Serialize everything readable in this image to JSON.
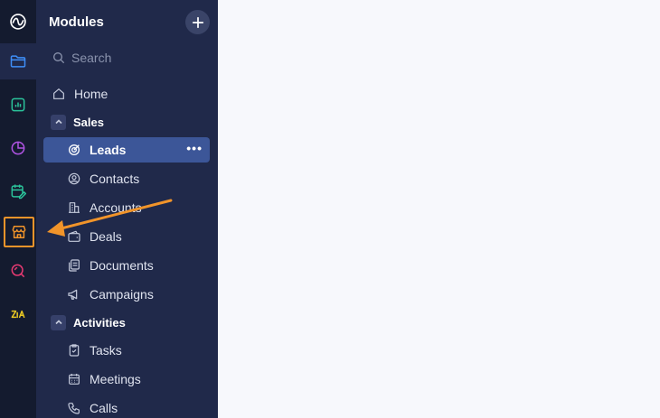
{
  "panel": {
    "title": "Modules",
    "search_placeholder": "Search"
  },
  "rail": {
    "items": [
      {
        "icon": "crm-logo-icon"
      },
      {
        "icon": "folder-icon",
        "active": true
      },
      {
        "icon": "analytics-icon"
      },
      {
        "icon": "pie-chart-icon"
      },
      {
        "icon": "calendar-edit-icon"
      },
      {
        "icon": "storefront-icon",
        "highlighted": true
      },
      {
        "icon": "search-zoom-icon"
      },
      {
        "icon": "zia-icon",
        "label": "Zia"
      }
    ]
  },
  "nav": {
    "home": "Home",
    "sales": {
      "label": "Sales",
      "items": [
        "Leads",
        "Contacts",
        "Accounts",
        "Deals",
        "Documents",
        "Campaigns"
      ]
    },
    "activities": {
      "label": "Activities",
      "items": [
        "Tasks",
        "Meetings",
        "Calls"
      ]
    },
    "more_label": "•••"
  },
  "colors": {
    "rail_bg": "#141b2f",
    "panel_bg": "#20294a",
    "active_item": "#3c5698",
    "highlight": "#f1942a",
    "content_bg": "#f7f8fc"
  }
}
